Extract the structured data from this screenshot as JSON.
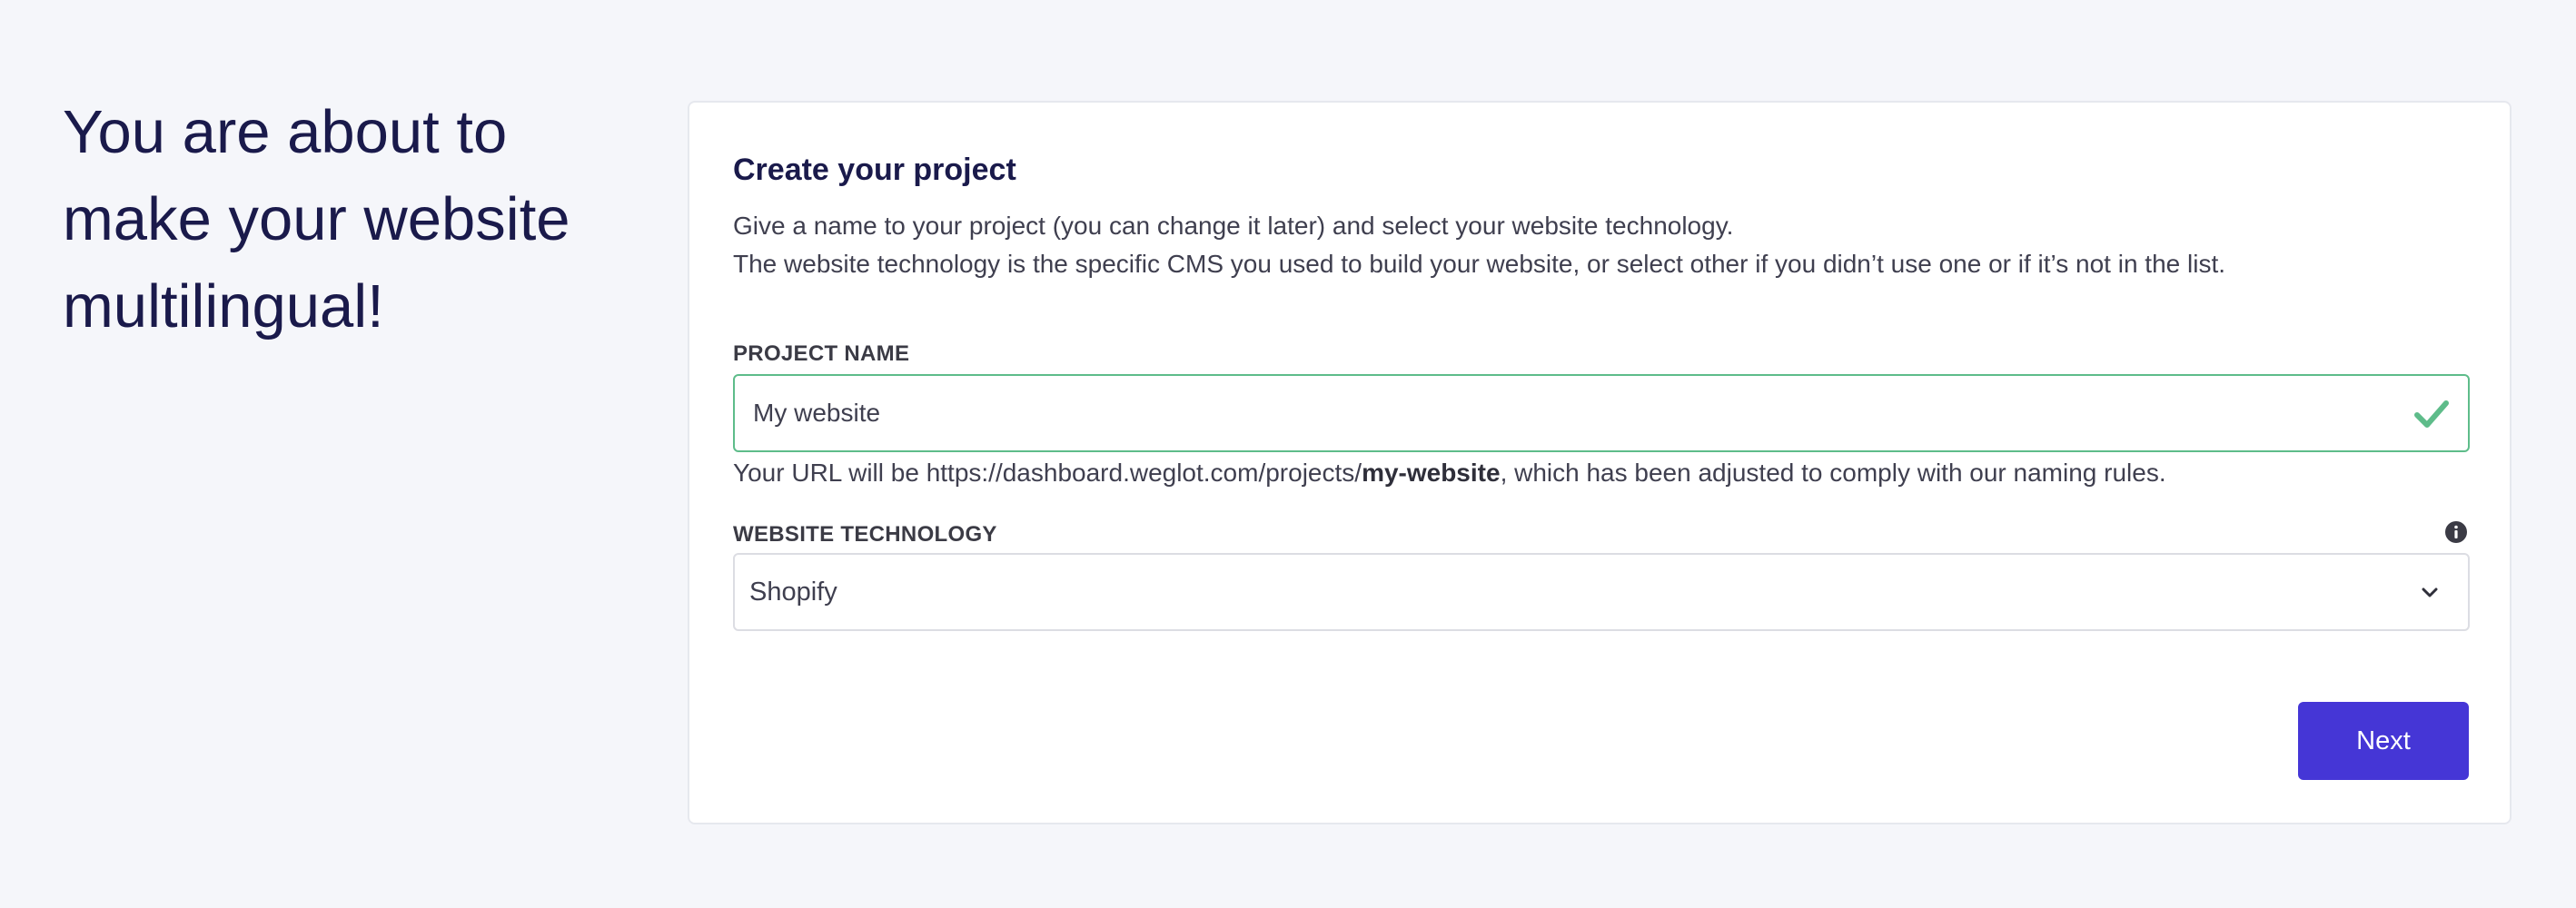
{
  "hero": {
    "line1": "You are about to",
    "line2": "make your website",
    "line3": "multilingual!"
  },
  "card": {
    "title": "Create your project",
    "description_line1": "Give a name to your project (you can change it later) and select your website technology.",
    "description_line2": "The website technology is the specific CMS you used to build your website, or select other if you didn’t use one or if it’s not in the list."
  },
  "project_name": {
    "label": "PROJECT NAME",
    "value": "My website",
    "status_icon": "check-icon",
    "status_color": "#5ebc8a",
    "url_hint_prefix": "Your URL will be https://dashboard.weglot.com/projects/",
    "url_slug": "my-website",
    "url_hint_suffix": ", which has been adjusted to comply with our naming rules."
  },
  "website_technology": {
    "label": "WEBSITE TECHNOLOGY",
    "info_icon": "info-icon",
    "selected": "Shopify",
    "dropdown_icon": "chevron-down-icon"
  },
  "actions": {
    "next_label": "Next",
    "accent_color": "#4536d6"
  }
}
